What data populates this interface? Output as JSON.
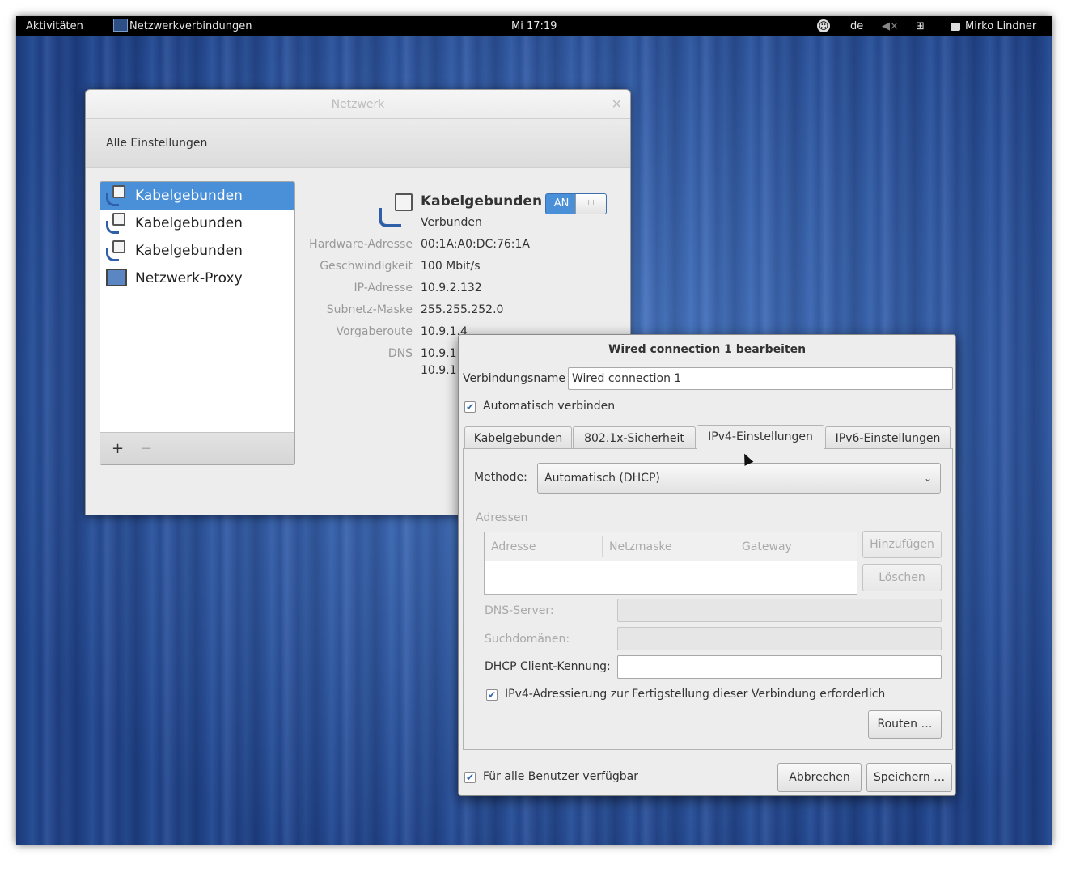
{
  "topbar": {
    "activities": "Aktivitäten",
    "app_name": "Netzwerkverbindungen",
    "clock": "Mi 17:19",
    "language": "de",
    "user": "Mirko Lindner"
  },
  "network_window": {
    "title": "Netzwerk",
    "all_settings": "Alle Einstellungen",
    "devices": [
      {
        "label": "Kabelgebunden",
        "icon": "wired-network-icon",
        "selected": true
      },
      {
        "label": "Kabelgebunden",
        "icon": "wired-network-icon",
        "selected": false
      },
      {
        "label": "Kabelgebunden",
        "icon": "wired-network-locked-icon",
        "selected": false
      },
      {
        "label": "Netzwerk-Proxy",
        "icon": "network-proxy-icon",
        "selected": false
      }
    ],
    "add_label": "+",
    "remove_label": "−",
    "detail": {
      "name": "Kabelgebunden",
      "status": "Verbunden",
      "switch_on": "AN",
      "switch_knob": "III",
      "props": [
        {
          "key": "Hardware-Adresse",
          "value": "00:1A:A0:DC:76:1A"
        },
        {
          "key": "Geschwindigkeit",
          "value": "100 Mbit/s"
        },
        {
          "key": "IP-Adresse",
          "value": "10.9.2.132"
        },
        {
          "key": "Subnetz-Maske",
          "value": "255.255.252.0"
        },
        {
          "key": "Vorgaberoute",
          "value": "10.9.1.4"
        },
        {
          "key": "DNS",
          "value": "10.9.1"
        }
      ],
      "dns_second": "10.9.1"
    }
  },
  "edit_dialog": {
    "title": "Wired connection 1 bearbeiten",
    "name_label": "Verbindungsname",
    "name_value": "Wired connection 1",
    "autoconnect_label": "Automatisch verbinden",
    "tabs": [
      "Kabelgebunden",
      "802.1x-Sicherheit",
      "IPv4-Einstellungen",
      "IPv6-Einstellungen"
    ],
    "active_tab": "IPv4-Einstellungen",
    "method_label": "Methode:",
    "method_value": "Automatisch (DHCP)",
    "addresses_label": "Adressen",
    "columns": [
      "Adresse",
      "Netzmaske",
      "Gateway"
    ],
    "add_button": "Hinzufügen",
    "delete_button": "Löschen",
    "dns_label": "DNS-Server:",
    "search_label": "Suchdomänen:",
    "dhcp_label": "DHCP Client-Kennung:",
    "ipv4_required_label": "IPv4-Adressierung zur Fertigstellung dieser Verbindung erforderlich",
    "routes_button": "Routen …",
    "all_users_label": "Für alle Benutzer verfügbar",
    "cancel_button": "Abbrechen",
    "save_button": "Speichern …",
    "check_mark": "✔"
  },
  "colors": {
    "selection": "#4a90d9",
    "topbar": "#000000",
    "desktop": "#2e58a6"
  }
}
